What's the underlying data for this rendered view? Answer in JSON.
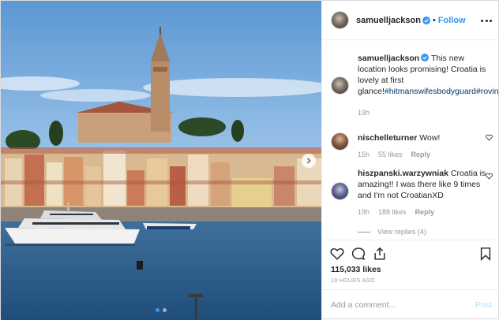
{
  "post": {
    "author": "samuelljackson",
    "follow_label": "Follow",
    "separator": "•",
    "caption_text": "This new location looks promising! Croatia is lovely at first glance!",
    "caption_tags": "#hitmanswifesbodyguard#rovinj",
    "caption_time": "19h",
    "likes_text": "115,033 likes",
    "time_ago": "19 HOURS AGO",
    "add_comment_placeholder": "Add a comment...",
    "post_label": "Post"
  },
  "comments": [
    {
      "username": "nischelleturner",
      "text": "Wow!",
      "time": "15h",
      "likes": "55 likes",
      "reply": "Reply"
    },
    {
      "username": "hiszpanski.warzywniak",
      "text": "Croatia is amazing!! I was there like 9 times and I'm not CroatianXD",
      "time": "19h",
      "likes": "188 likes",
      "reply": "Reply",
      "view_replies": "View replies (4)"
    }
  ],
  "icons": {
    "verified": "verified-badge-icon",
    "more": "more-options-icon",
    "heart": "heart-icon",
    "comment": "comment-icon",
    "share": "share-icon",
    "bookmark": "bookmark-icon",
    "next": "chevron-right-icon"
  },
  "carousel": {
    "slide_count": 2,
    "active_index": 0
  },
  "colors": {
    "accent": "#3897f0",
    "verified": "#3897f0",
    "muted": "#999999",
    "text": "#262626",
    "post_disabled": "#b2dffc"
  }
}
